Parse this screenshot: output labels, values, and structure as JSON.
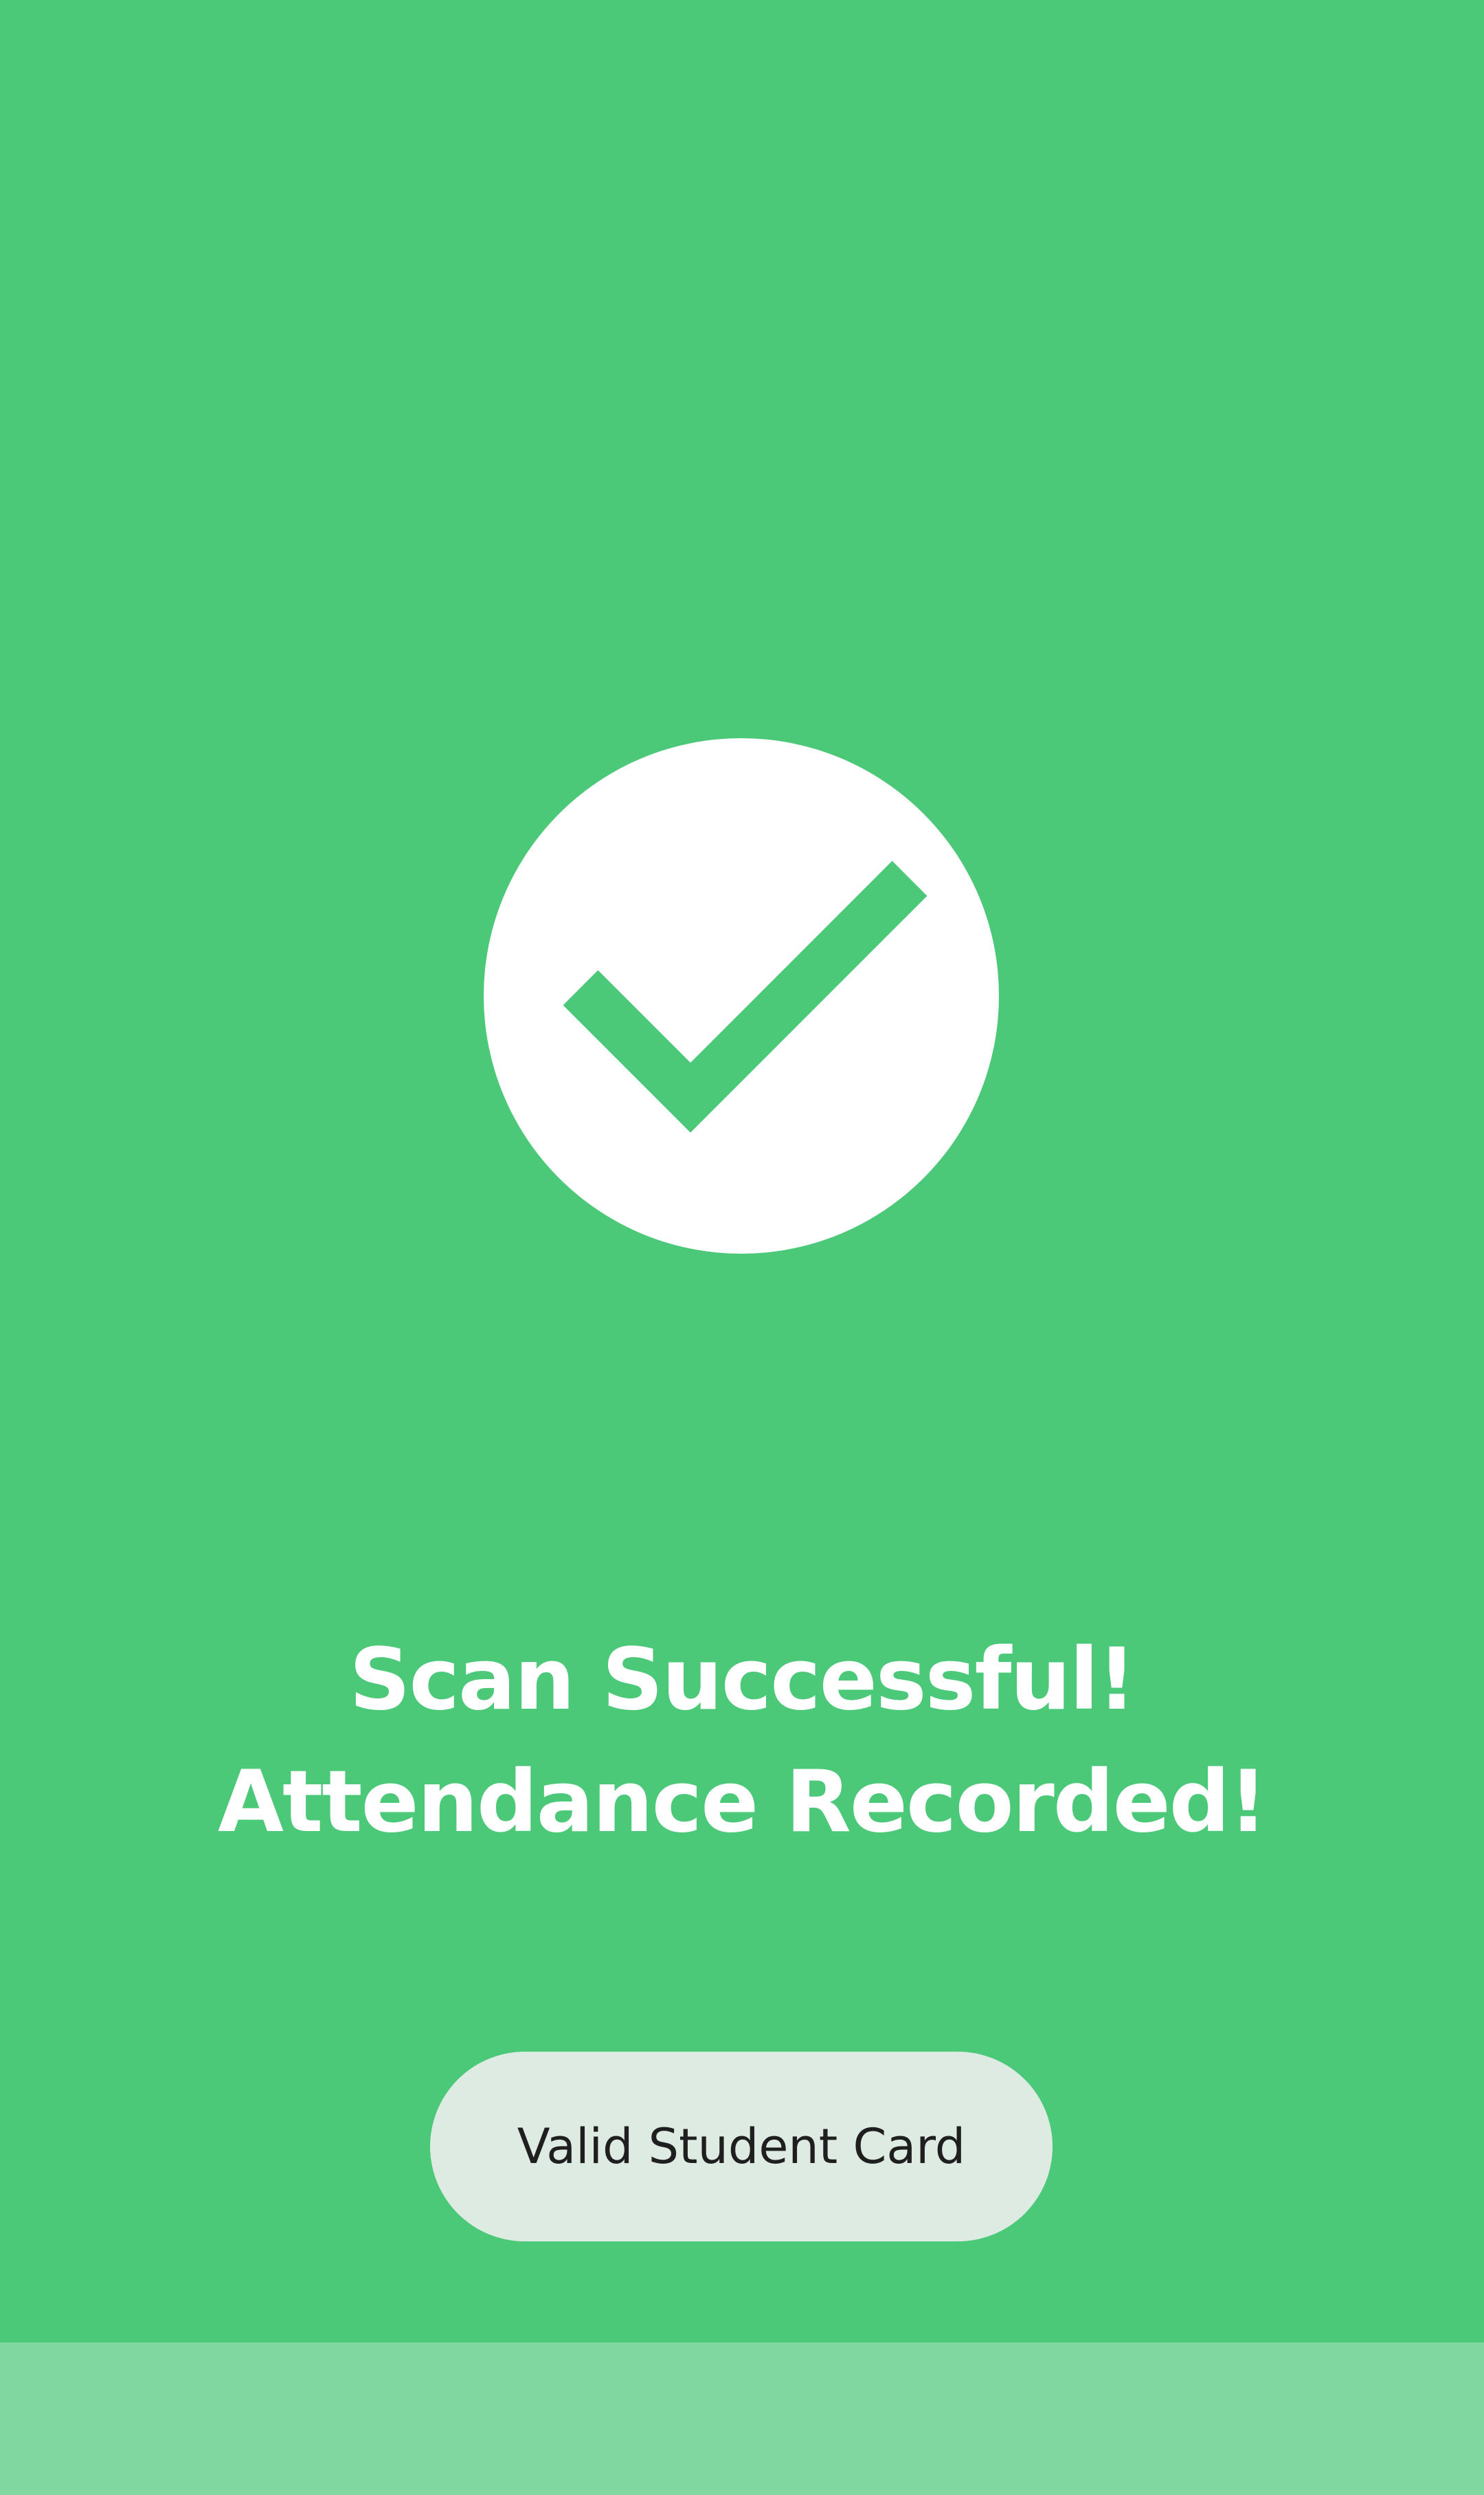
{
  "screen": {
    "background_color": "#4BC878",
    "status_icon": "check-circle-icon",
    "headline_line1": "Scan Successful!",
    "headline_line2": "Attendance Recorded!",
    "card_status_label": "Valid Student Card",
    "pill_color": "#DDEBE3",
    "bottom_band_color": "#80D8A0"
  }
}
